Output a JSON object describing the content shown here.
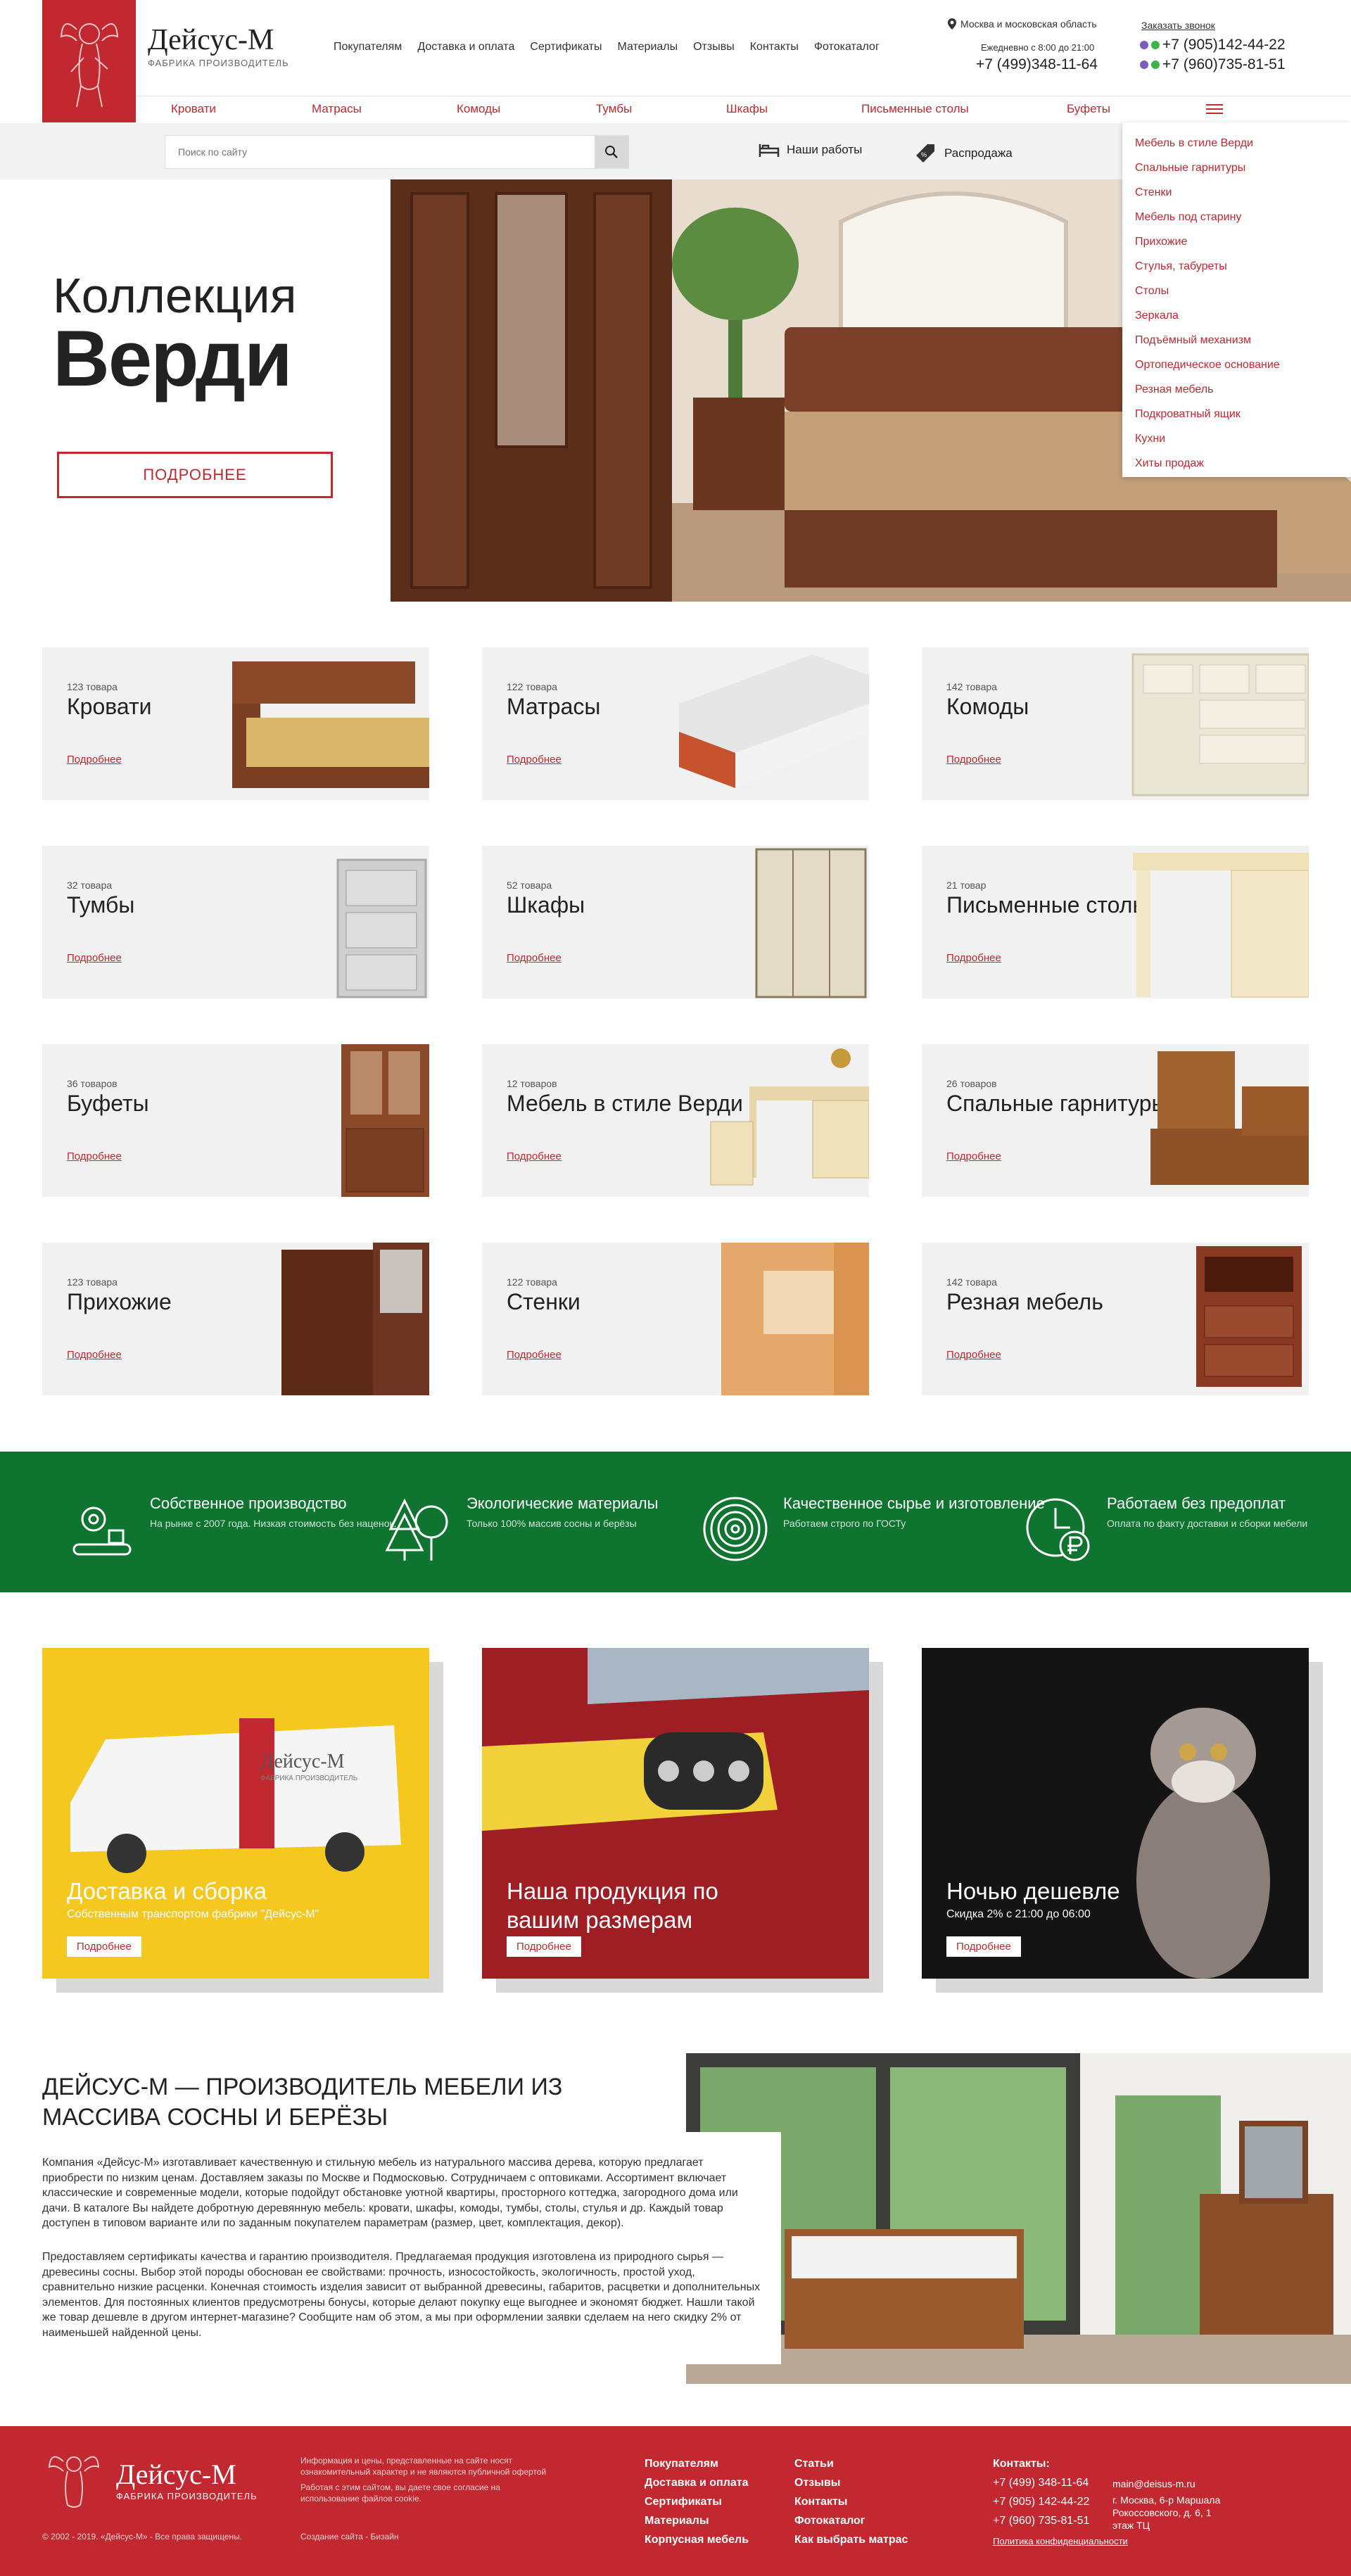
{
  "brand": {
    "name": "Дейсус-М",
    "sub": "ФАБРИКА ПРОИЗВОДИТЕЛЬ"
  },
  "topnav": [
    "Покупателям",
    "Доставка и оплата",
    "Сертификаты",
    "Материалы",
    "Отзывы",
    "Контакты",
    "Фотокаталог"
  ],
  "contacts": {
    "region": "Москва и московская область",
    "hours": "Ежедневно с 8:00 до 21:00",
    "phone_main": "+7 (499)348-11-64",
    "callback": "Заказать звонок",
    "phone2": "+7 (905)142-44-22",
    "phone3": "+7 (960)735-81-51"
  },
  "catnav": [
    "Кровати",
    "Матрасы",
    "Комоды",
    "Тумбы",
    "Шкафы",
    "Письменные столы",
    "Буфеты"
  ],
  "search": {
    "placeholder": "Поиск по сайту"
  },
  "quicklinks": {
    "works": "Наши работы",
    "sale": "Распродажа",
    "sale_badge": "%"
  },
  "dropdown": [
    "Мебель в стиле Верди",
    "Спальные гарнитуры",
    "Стенки",
    "Мебель под старину",
    "Прихожие",
    "Стулья, табуреты",
    "Столы",
    "Зеркала",
    "Подъёмный механизм",
    "Ортопедическое основание",
    "Резная мебель",
    "Подкроватный ящик",
    "Кухни",
    "Хиты продаж"
  ],
  "hero": {
    "line1": "Коллекция",
    "line2": "Верди",
    "button": "ПОДРОБНЕЕ"
  },
  "categories": [
    {
      "count": "123 товара",
      "title": "Кровати",
      "more": "Подробнее"
    },
    {
      "count": "122 товара",
      "title": "Матрасы",
      "more": "Подробнее"
    },
    {
      "count": "142 товара",
      "title": "Комоды",
      "more": "Подробнее"
    },
    {
      "count": "32 товара",
      "title": "Тумбы",
      "more": "Подробнее"
    },
    {
      "count": "52 товара",
      "title": "Шкафы",
      "more": "Подробнее"
    },
    {
      "count": "21 товар",
      "title": "Письменные столы",
      "more": "Подробнее"
    },
    {
      "count": "36 товаров",
      "title": "Буфеты",
      "more": "Подробнее"
    },
    {
      "count": "12 товаров",
      "title": "Мебель в стиле Верди",
      "more": "Подробнее"
    },
    {
      "count": "26 товаров",
      "title": "Спальные гарнитуры",
      "more": "Подробнее"
    },
    {
      "count": "123 товара",
      "title": "Прихожие",
      "more": "Подробнее"
    },
    {
      "count": "122 товара",
      "title": "Стенки",
      "more": "Подробнее"
    },
    {
      "count": "142 товара",
      "title": "Резная мебель",
      "more": "Подробнее"
    }
  ],
  "features": [
    {
      "title": "Собственное производство",
      "sub": "На рынке с 2007 года. Низкая стоимость без наценок."
    },
    {
      "title": "Экологические материалы",
      "sub": "Только 100% массив сосны и берёзы"
    },
    {
      "title": "Качественное сырье и изготовление",
      "sub": "Работаем строго по ГОСТу"
    },
    {
      "title": "Работаем без предоплат",
      "sub": "Оплата по факту доставки и сборки мебели"
    }
  ],
  "promos": [
    {
      "title": "Доставка и сборка",
      "sub": "Собственным транспортом фабрики \"Дейсус-М\"",
      "button": "Подробнее",
      "van_text": "Дейсус-М",
      "van_sub": "ФАБРИКА ПРОИЗВОДИТЕЛЬ"
    },
    {
      "title": "Наша продукция по вашим размерам",
      "sub": "",
      "button": "Подробнее"
    },
    {
      "title": "Ночью дешевле",
      "sub": "Скидка 2% с 21:00 до 06:00",
      "button": "Подробнее"
    }
  ],
  "about": {
    "title": "ДЕЙСУС-М — ПРОИЗВОДИТЕЛЬ МЕБЕЛИ ИЗ МАССИВА СОСНЫ И БЕРЁЗЫ",
    "p1": "Компания «Дейсус-М» изготавливает качественную и стильную мебель из натурального массива дерева, которую предлагает приобрести по низким ценам. Доставляем заказы по Москве и Подмосковью. Сотрудничаем с оптовиками. Ассортимент включает классические и современные модели, которые подойдут обстановке уютной квартиры, просторного коттеджа, загородного дома или дачи. В каталоге Вы найдете добротную деревянную мебель: кровати, шкафы, комоды, тумбы, столы, стулья и др. Каждый товар доступен в типовом варианте или по заданным покупателем параметрам (размер, цвет, комплектация, декор).",
    "p2": "Предоставляем сертификаты качества и гарантию производителя. Предлагаемая продукция изготовлена из природного сырья — древесины сосны. Выбор этой породы обоснован ее свойствами: прочность, износостойкость, экологичность, простой уход, сравнительно низкие расценки. Конечная стоимость изделия зависит от выбранной древесины, габаритов, расцветки и дополнительных элементов. Для постоянных клиентов предусмотрены бонусы, которые делают покупку еще выгоднее и экономят бюджет. Нашли такой же товар дешевле в другом интернет-магазине? Сообщите нам об этом, а мы при оформлении заявки сделаем на него скидку 2% от наименьшей найденной цены."
  },
  "footer": {
    "brand": "Дейсус-М",
    "brand_sub": "ФАБРИКА ПРОИЗВОДИТЕЛЬ",
    "disclaimer": "Информация и цены, представленные на сайте носят ознакомительный характер и не являются публичной офертой",
    "cookies": "Работая с этим сайтом, вы даете свое согласие на использование файлов cookie.",
    "copyright": "© 2002 - 2019. «Дейсус-М» - Все права защищены.",
    "made": "Создание сайта -",
    "made_by": "Бизайн",
    "col1": [
      "Покупателям",
      "Доставка и оплата",
      "Сертификаты",
      "Материалы",
      "Корпусная мебель"
    ],
    "col2": [
      "Статьи",
      "Отзывы",
      "Контакты",
      "Фотокаталог",
      "Как выбрать матрас"
    ],
    "contacts_title": "Контакты:",
    "phones": [
      "+7 (499) 348-11-64",
      "+7 (905) 142-44-22",
      "+7 (960) 735-81-51"
    ],
    "email": "main@deisus-m.ru",
    "address": "г. Москва, 6-р Маршала Рокоссовского, д. 6, 1 этаж ТЦ",
    "privacy": "Политика конфиденциальности"
  },
  "colors": {
    "accent": "#c1282f",
    "green": "#0f7430",
    "card_bg": "#f1f1f1"
  }
}
